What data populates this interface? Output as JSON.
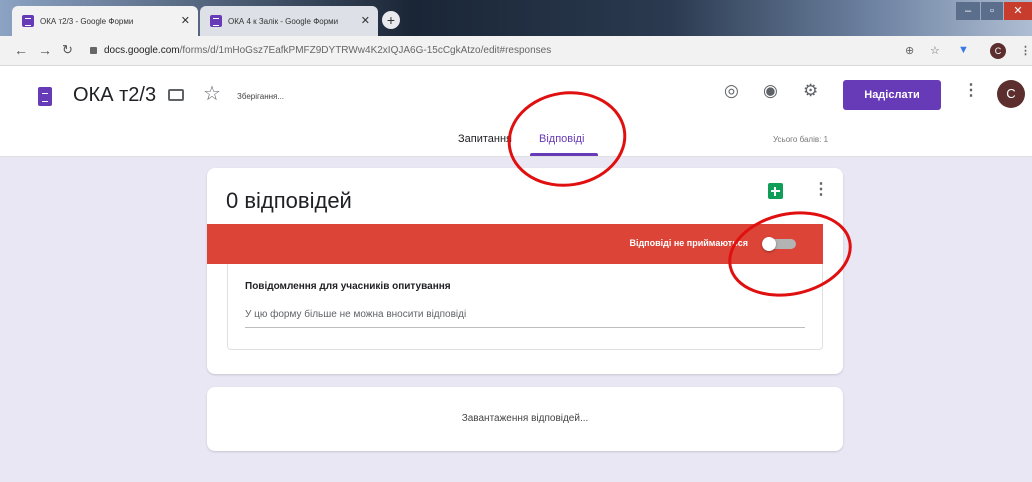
{
  "browser": {
    "tabs": [
      {
        "title": "ОКА т2/3 - Google Форми",
        "active": true
      },
      {
        "title": "ОКА 4 к Залік - Google Форми",
        "active": false
      }
    ],
    "url_host": "docs.google.com",
    "url_path": "/forms/d/1mHoGsz7EafkPMFZ9DYTRWw4K2xIQJA6G-15cCgkAtzo/edit#responses",
    "profile_initial": "C"
  },
  "header": {
    "form_title": "ОКА т2/3",
    "save_status": "Зберігання...",
    "send_label": "Надіслати",
    "user_initial": "C",
    "accent_color": "#673ab7"
  },
  "tabs": {
    "questions": "Запитання",
    "responses": "Відповіді",
    "total_points": "Усього балів: 1"
  },
  "responses_card": {
    "count_label": "0 відповідей",
    "banner_text": "Відповіді не приймаються",
    "banner_color": "#db4437",
    "accepting_responses": false,
    "message_label": "Повідомлення для учасників опитування",
    "message_value": "У цю форму більше не можна вносити відповіді"
  },
  "loading": {
    "text": "Завантаження відповідей..."
  }
}
